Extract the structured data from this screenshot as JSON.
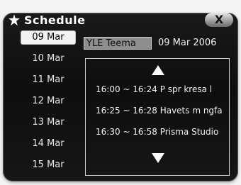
{
  "window": {
    "title": "Schedule",
    "close_label": "X"
  },
  "dates": {
    "items": [
      "09 Mar",
      "10 Mar",
      "11 Mar",
      "12 Mar",
      "13 Mar",
      "14 Mar",
      "15 Mar"
    ],
    "selected_index": 0
  },
  "channel": {
    "name": "YLE Teema",
    "date": "09 Mar 2006"
  },
  "programs": [
    {
      "time": "16:00 ~ 16:24",
      "title": "P spr kresa l"
    },
    {
      "time": "16:25 ~ 16:28",
      "title": "Havets m ngfa"
    },
    {
      "time": "16:30 ~ 16:58",
      "title": "Prisma Studio"
    }
  ],
  "icons": {
    "title": "star-icon",
    "up": "arrow-up-icon",
    "down": "arrow-down-icon"
  },
  "colors": {
    "panel_background": "#111111",
    "selected_background": "#f2f2f2",
    "channel_background": "#8e8e8e",
    "text": "#f0f0f0"
  }
}
